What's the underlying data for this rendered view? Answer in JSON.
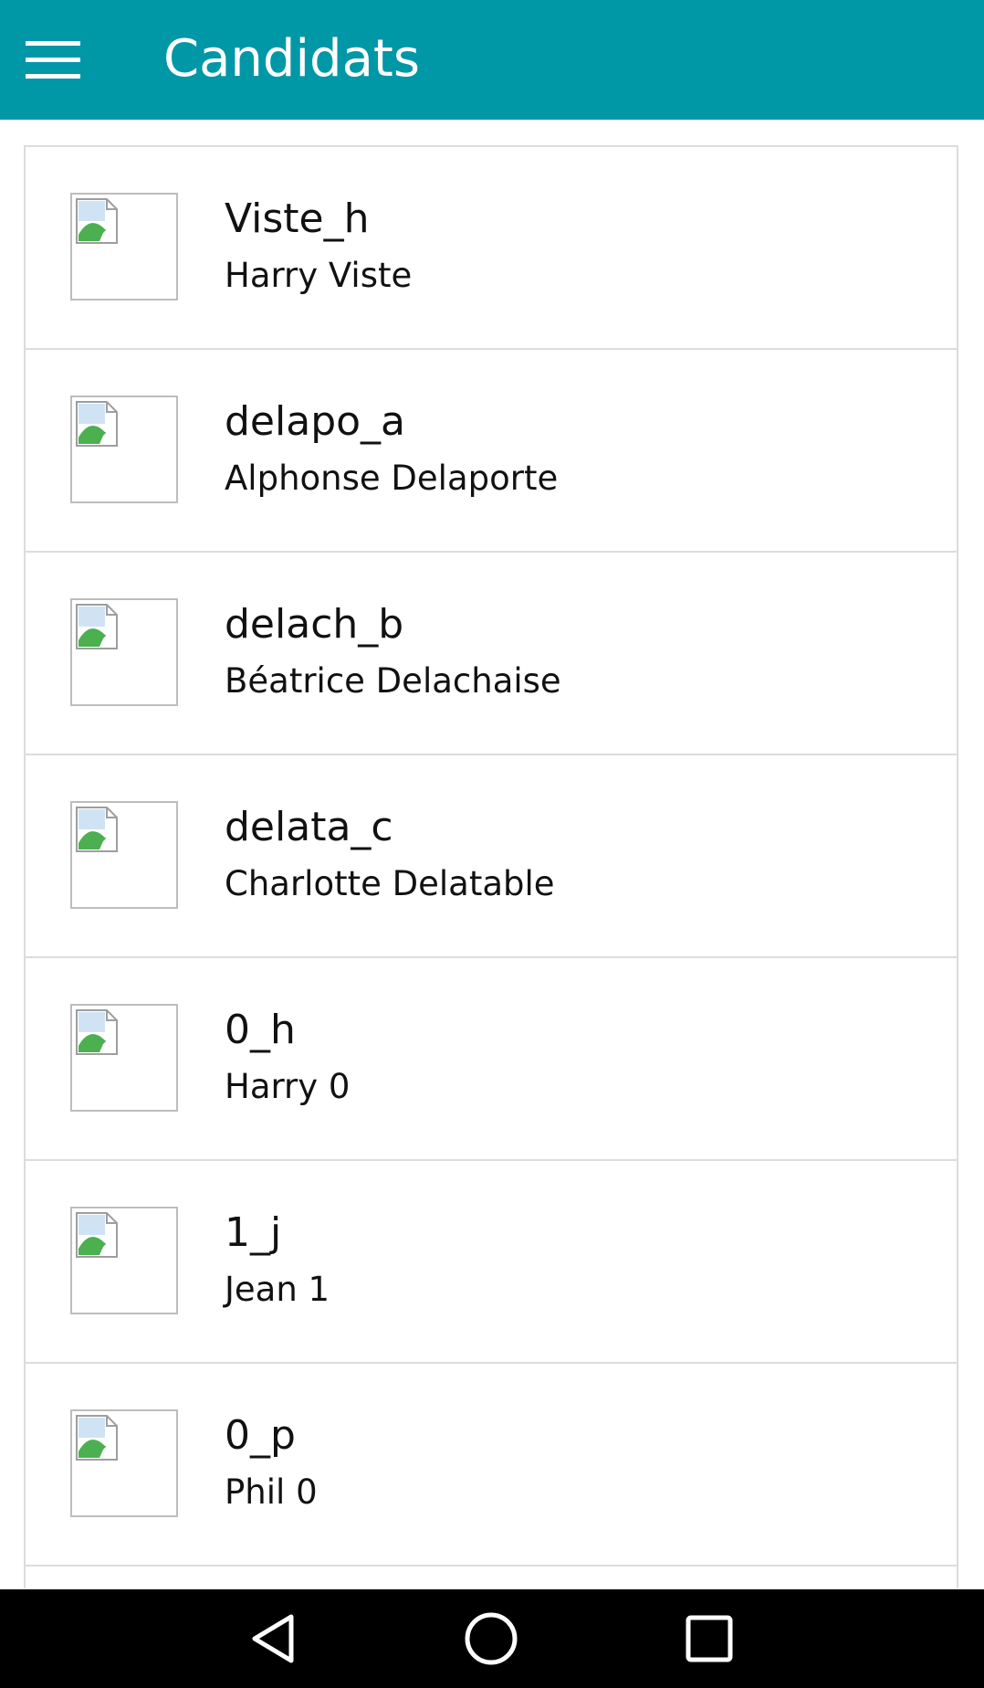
{
  "app_bar": {
    "title": "Candidats",
    "menu_icon": "hamburger-menu-icon",
    "background_color": "#0097a7"
  },
  "candidates": [
    {
      "login": "Viste_h",
      "name": "Harry Viste",
      "avatar_icon": "broken-image-icon"
    },
    {
      "login": "delapo_a",
      "name": "Alphonse Delaporte",
      "avatar_icon": "broken-image-icon"
    },
    {
      "login": "delach_b",
      "name": "Béatrice Delachaise",
      "avatar_icon": "broken-image-icon"
    },
    {
      "login": "delata_c",
      "name": "Charlotte Delatable",
      "avatar_icon": "broken-image-icon"
    },
    {
      "login": "0_h",
      "name": "Harry 0",
      "avatar_icon": "broken-image-icon"
    },
    {
      "login": "1_j",
      "name": "Jean 1",
      "avatar_icon": "broken-image-icon"
    },
    {
      "login": "0_p",
      "name": "Phil 0",
      "avatar_icon": "broken-image-icon"
    }
  ],
  "system_nav": {
    "back_icon": "back-triangle-icon",
    "home_icon": "home-circle-icon",
    "recents_icon": "recents-square-icon"
  }
}
